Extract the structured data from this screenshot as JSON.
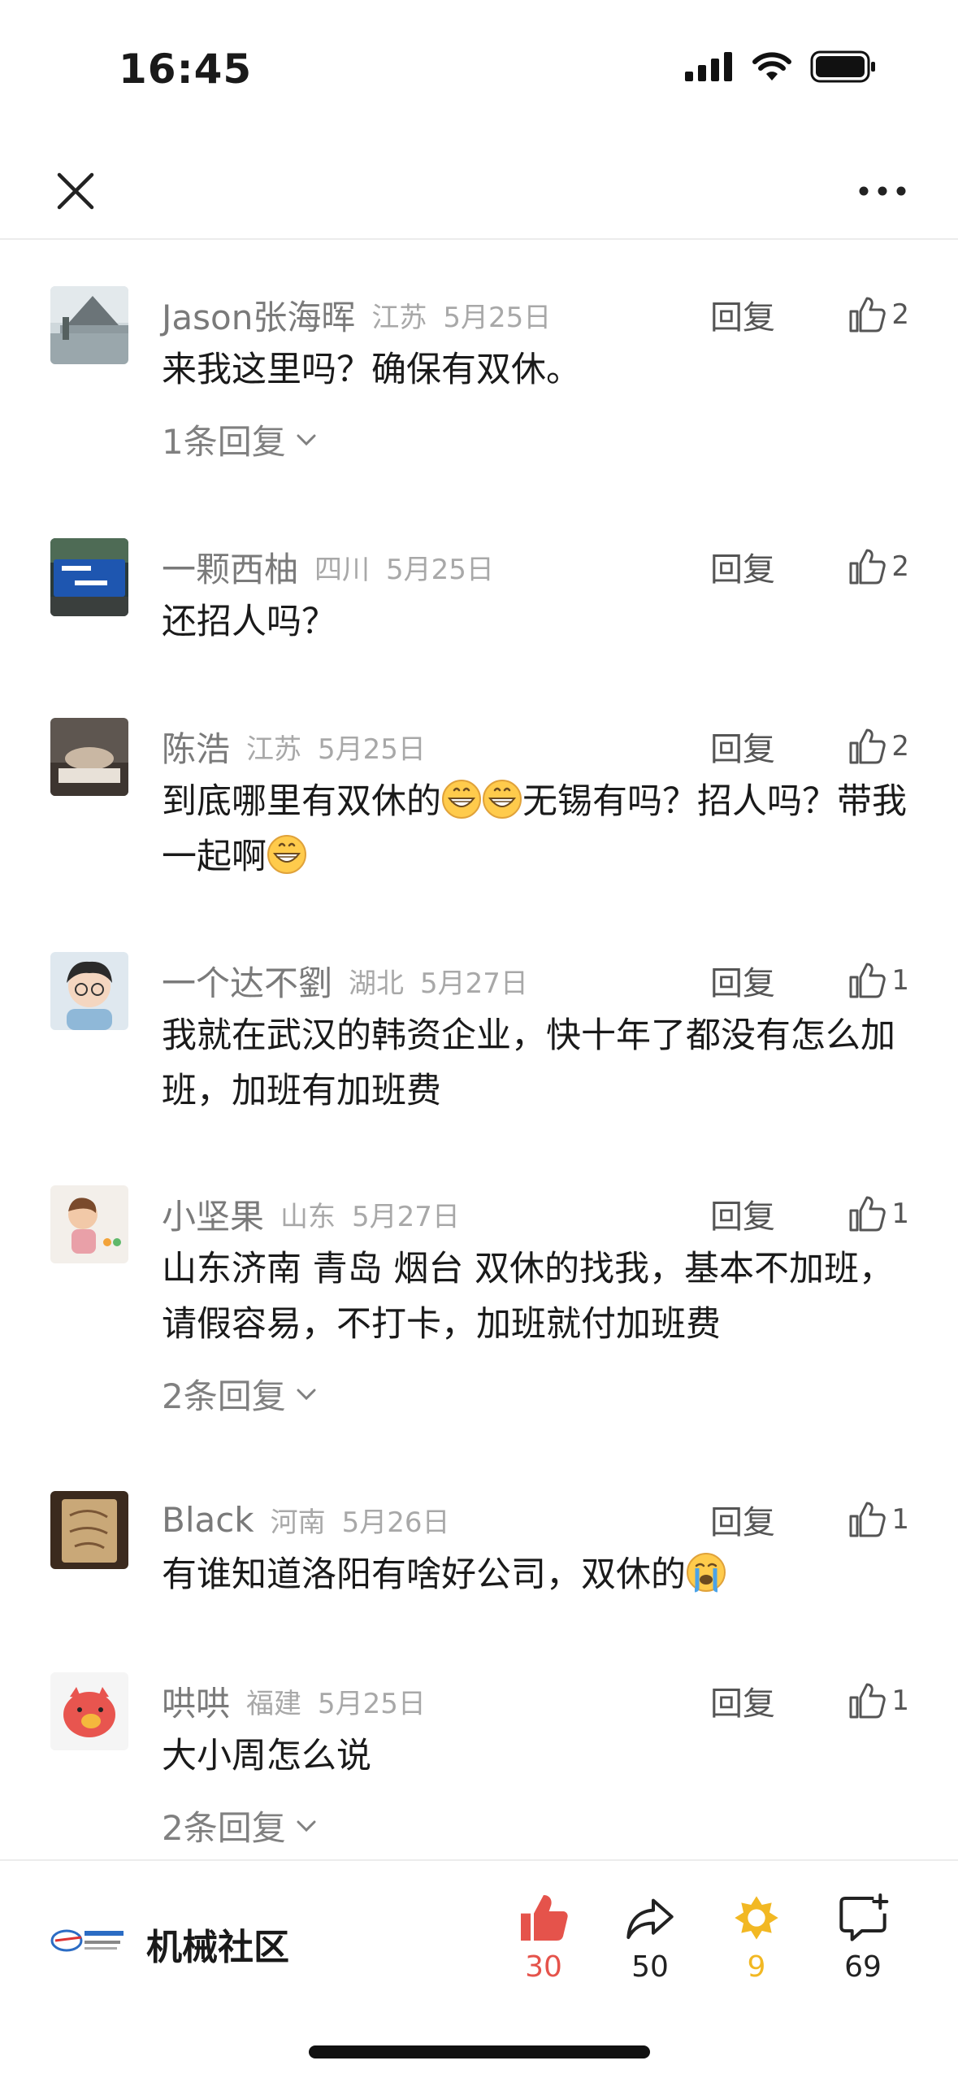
{
  "status_bar": {
    "time": "16:45"
  },
  "comments": [
    {
      "name": "Jason张海晖",
      "region": "江苏",
      "date": "5月25日",
      "reply_label": "回复",
      "likes": "2",
      "text": "来我这里吗？确保有双休。",
      "replies_label": "1条回复"
    },
    {
      "name": "一颗西柚",
      "region": "四川",
      "date": "5月25日",
      "reply_label": "回复",
      "likes": "2",
      "text": "还招人吗？",
      "replies_label": ""
    },
    {
      "name": "陈浩",
      "region": "江苏",
      "date": "5月25日",
      "reply_label": "回复",
      "likes": "2",
      "text_a": "到底哪里有双休的",
      "text_b": "无锡有吗？招人吗？带我一起啊",
      "replies_label": ""
    },
    {
      "name": "一个达不劉",
      "region": "湖北",
      "date": "5月27日",
      "reply_label": "回复",
      "likes": "1",
      "text": "我就在武汉的韩资企业，快十年了都没有怎么加班，加班有加班费",
      "replies_label": ""
    },
    {
      "name": "小坚果",
      "region": "山东",
      "date": "5月27日",
      "reply_label": "回复",
      "likes": "1",
      "text": "山东济南 青岛 烟台 双休的找我，基本不加班，请假容易，不打卡，加班就付加班费",
      "replies_label": "2条回复"
    },
    {
      "name": "Black",
      "region": "河南",
      "date": "5月26日",
      "reply_label": "回复",
      "likes": "1",
      "text": "有谁知道洛阳有啥好公司，双休的",
      "replies_label": ""
    },
    {
      "name": "哄哄",
      "region": "福建",
      "date": "5月25日",
      "reply_label": "回复",
      "likes": "1",
      "text": "大小周怎么说",
      "replies_label": "2条回复"
    }
  ],
  "bottom_bar": {
    "community_name": "机械社区",
    "like_count": "30",
    "share_count": "50",
    "collect_count": "9",
    "comment_count": "69"
  },
  "colors": {
    "like_red": "#e5534b",
    "collect_gold": "#f2b823",
    "meta_gray": "#a8a8a8"
  },
  "icons": [
    "close-icon",
    "more-icon",
    "thumbs-up-icon",
    "chevron-down-icon",
    "share-icon",
    "collect-icon",
    "comment-add-icon",
    "grin-emoji",
    "crying-emoji"
  ]
}
